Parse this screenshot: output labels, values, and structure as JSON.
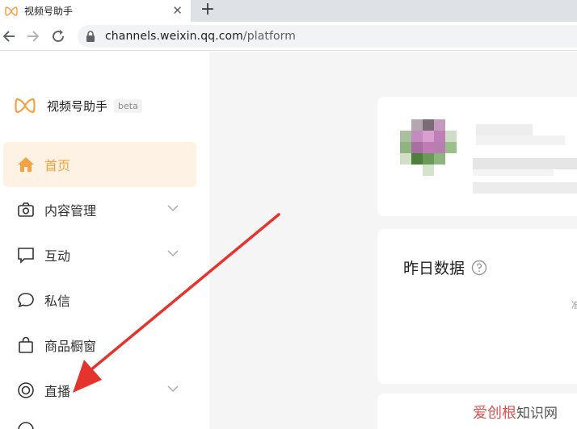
{
  "browser": {
    "tab_title": "视频号助手",
    "close_glyph": "✕",
    "newtab_glyph": "+",
    "url_host": "channels.weixin.qq.com",
    "url_path": "/platform"
  },
  "sidebar": {
    "brand_name": "视频号助手",
    "beta": "beta",
    "items": [
      {
        "label": "首页",
        "icon": "home-icon",
        "active": true
      },
      {
        "label": "内容管理",
        "icon": "camera-icon",
        "expandable": true
      },
      {
        "label": "互动",
        "icon": "comment-icon",
        "expandable": true
      },
      {
        "label": "私信",
        "icon": "message-icon"
      },
      {
        "label": "商品橱窗",
        "icon": "shopping-bag-icon"
      },
      {
        "label": "直播",
        "icon": "live-icon",
        "expandable": true
      }
    ]
  },
  "main": {
    "yesterday_title": "昨日数据",
    "edge_text": "准"
  },
  "watermark": {
    "part1": "爱创根",
    "part2": "知识网"
  },
  "colors": {
    "accent": "#f4a343",
    "active_bg": "#fdf2e4",
    "arrow": "#e5342e"
  }
}
